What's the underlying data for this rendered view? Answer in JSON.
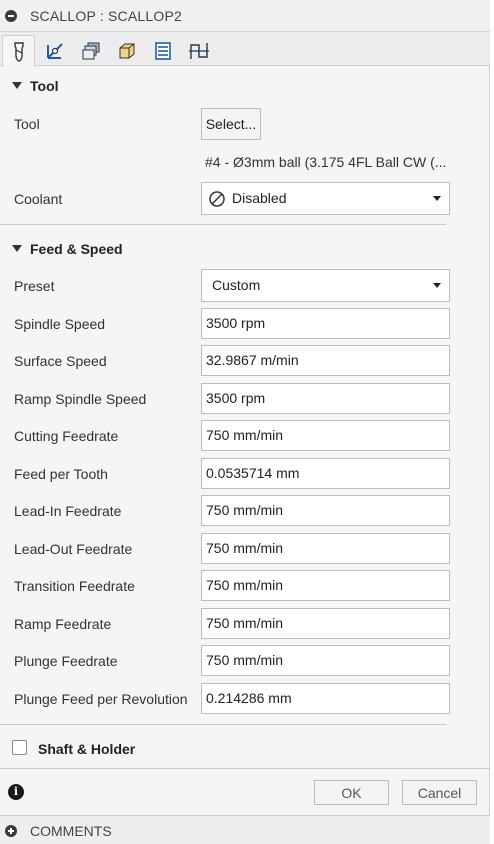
{
  "window": {
    "title": "SCALLOP : SCALLOP2"
  },
  "tabs": [
    {
      "name": "tool-tab-icon"
    },
    {
      "name": "geometry-tab-icon"
    },
    {
      "name": "heights-tab-icon"
    },
    {
      "name": "passes-tab-icon"
    },
    {
      "name": "linking-tab-icon"
    },
    {
      "name": "simulation-tab-icon"
    }
  ],
  "tool_section": {
    "title": "Tool",
    "tool_label": "Tool",
    "select_button": "Select...",
    "tool_description": "#4 - Ø3mm ball (3.175 4FL Ball CW  (...",
    "coolant_label": "Coolant",
    "coolant_value": "Disabled"
  },
  "feed_section": {
    "title": "Feed & Speed",
    "preset_label": "Preset",
    "preset_value": "Custom",
    "rows": [
      {
        "label": "Spindle Speed",
        "value": "3500 rpm"
      },
      {
        "label": "Surface Speed",
        "value": "32.9867 m/min"
      },
      {
        "label": "Ramp Spindle Speed",
        "value": "3500 rpm"
      },
      {
        "label": "Cutting Feedrate",
        "value": "750 mm/min"
      },
      {
        "label": "Feed per Tooth",
        "value": "0.0535714 mm"
      },
      {
        "label": "Lead-In Feedrate",
        "value": "750 mm/min"
      },
      {
        "label": "Lead-Out Feedrate",
        "value": "750 mm/min"
      },
      {
        "label": "Transition Feedrate",
        "value": "750 mm/min"
      },
      {
        "label": "Ramp Feedrate",
        "value": "750 mm/min"
      },
      {
        "label": "Plunge Feedrate",
        "value": "750 mm/min"
      },
      {
        "label": "Plunge Feed per Revolution",
        "value": "0.214286 mm"
      }
    ]
  },
  "shaft_section": {
    "title": "Shaft & Holder"
  },
  "buttons": {
    "ok": "OK",
    "cancel": "Cancel"
  },
  "footer": {
    "label": "COMMENTS"
  },
  "colors": {
    "panel": "#f5f5f5",
    "tab_icon_blue": "#1f5fa8",
    "border": "#bdbdbd"
  }
}
